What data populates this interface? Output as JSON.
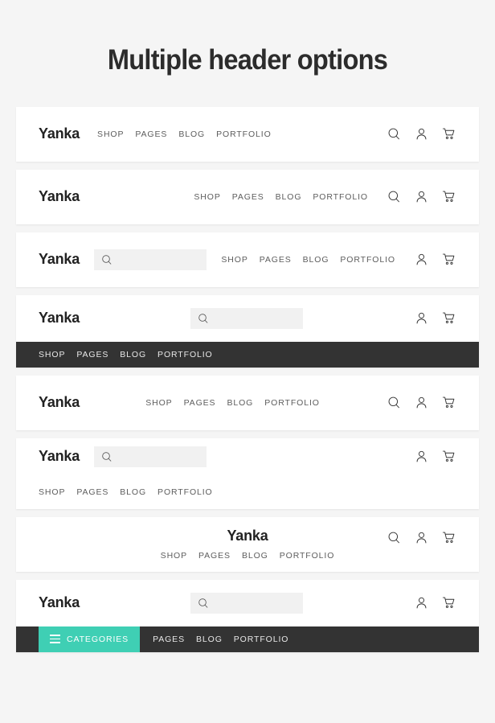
{
  "page": {
    "title": "Multiple header options",
    "background_color": "#f5f5f5",
    "accent_color": "#3fcfb4",
    "dark_bar_color": "#333333",
    "search_field_color": "#f1f1f1"
  },
  "brand": {
    "logo": "Yanka"
  },
  "nav": {
    "items": [
      "SHOP",
      "PAGES",
      "BLOG",
      "PORTFOLIO"
    ],
    "secondary_items": [
      "PAGES",
      "BLOG",
      "PORTFOLIO"
    ]
  },
  "icons": {
    "search": "search-icon",
    "account": "user-icon",
    "cart": "cart-icon",
    "menu": "hamburger-icon"
  },
  "search": {
    "value": "",
    "placeholder": ""
  },
  "categories_button": {
    "label": "CATEGORIES"
  },
  "headers": [
    {
      "name": "header-logo-left-nav-left-icons-right",
      "logo": "Yanka",
      "items": [
        "SHOP",
        "PAGES",
        "BLOG",
        "PORTFOLIO"
      ]
    },
    {
      "name": "header-logo-left-nav-right-icons-right",
      "logo": "Yanka",
      "items": [
        "SHOP",
        "PAGES",
        "BLOG",
        "PORTFOLIO"
      ]
    },
    {
      "name": "header-logo-search-nav-right",
      "logo": "Yanka",
      "items": [
        "SHOP",
        "PAGES",
        "BLOG",
        "PORTFOLIO"
      ]
    },
    {
      "name": "header-center-search-dark-nav-bar",
      "logo": "Yanka",
      "items": [
        "SHOP",
        "PAGES",
        "BLOG",
        "PORTFOLIO"
      ]
    },
    {
      "name": "header-logo-left-nav-center-icons-right",
      "logo": "Yanka",
      "items": [
        "SHOP",
        "PAGES",
        "BLOG",
        "PORTFOLIO"
      ]
    },
    {
      "name": "header-logo-search-nav-below",
      "logo": "Yanka",
      "items": [
        "SHOP",
        "PAGES",
        "BLOG",
        "PORTFOLIO"
      ]
    },
    {
      "name": "header-centered-logo-and-nav",
      "logo": "Yanka",
      "items": [
        "SHOP",
        "PAGES",
        "BLOG",
        "PORTFOLIO"
      ]
    },
    {
      "name": "header-categories-dark-nav-bar",
      "logo": "Yanka",
      "categories_label": "CATEGORIES",
      "items": [
        "PAGES",
        "BLOG",
        "PORTFOLIO"
      ]
    }
  ]
}
